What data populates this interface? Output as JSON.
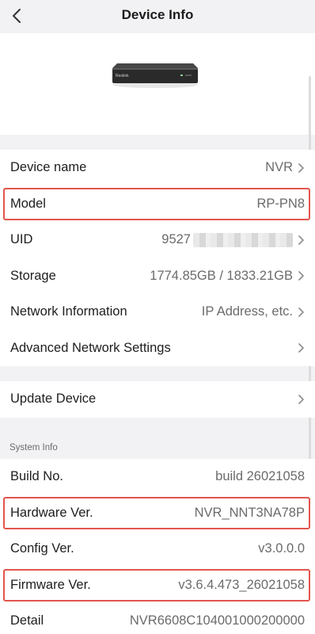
{
  "header": {
    "title": "Device Info"
  },
  "device_block": {
    "brand": "Reolink"
  },
  "device_rows": [
    {
      "label": "Device name",
      "value": "NVR"
    },
    {
      "label": "Model",
      "value": "RP-PN8"
    },
    {
      "label": "UID",
      "value": "9527"
    },
    {
      "label": "Storage",
      "value": "1774.85GB / 1833.21GB"
    },
    {
      "label": "Network Information",
      "value": "IP Address, etc."
    },
    {
      "label": "Advanced Network Settings",
      "value": ""
    }
  ],
  "update_row": {
    "label": "Update Device"
  },
  "system_info": {
    "section_title": "System Info",
    "rows": [
      {
        "label": "Build No.",
        "value": "build 26021058"
      },
      {
        "label": "Hardware Ver.",
        "value": "NVR_NNT3NA78P"
      },
      {
        "label": "Config Ver.",
        "value": "v3.0.0.0"
      },
      {
        "label": "Firmware Ver.",
        "value": "v3.6.4.473_26021058"
      },
      {
        "label": "Detail",
        "value": "NVR6608C104001000200000"
      }
    ]
  },
  "colors": {
    "highlight": "#e0564c",
    "background": "#f2f2f4"
  },
  "icons": {
    "back": "chevron-left-icon",
    "row_arrow": "chevron-right-icon"
  }
}
